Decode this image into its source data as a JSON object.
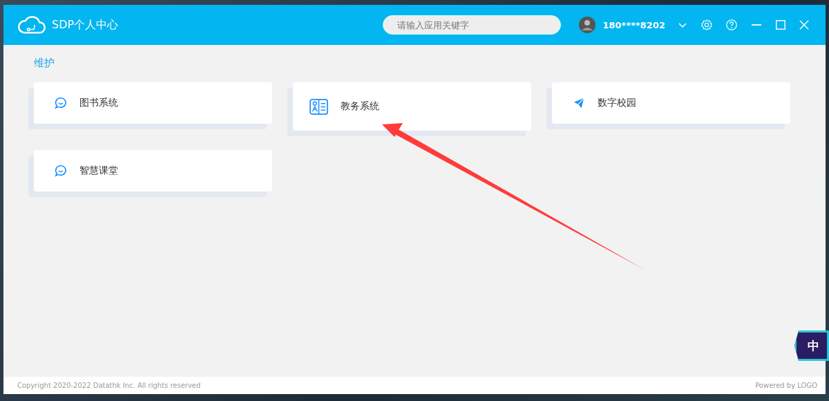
{
  "window": {
    "title": "SDP个人中心"
  },
  "search": {
    "placeholder": "请输入应用关键字"
  },
  "user": {
    "phone": "180****8202"
  },
  "section": {
    "title": "维护"
  },
  "apps": [
    {
      "name": "图书系统",
      "kind": "chat",
      "highlighted": false
    },
    {
      "name": "教务系统",
      "kind": "card",
      "highlighted": true
    },
    {
      "name": "数字校园",
      "kind": "plane",
      "highlighted": false
    },
    {
      "name": "智慧课堂",
      "kind": "chat",
      "highlighted": false
    }
  ],
  "footer": {
    "copyright": "Copyright 2020-2022 Datathk Inc. All rights reserved",
    "powered": "Powered by LOGO"
  },
  "ime": {
    "label": "中"
  }
}
